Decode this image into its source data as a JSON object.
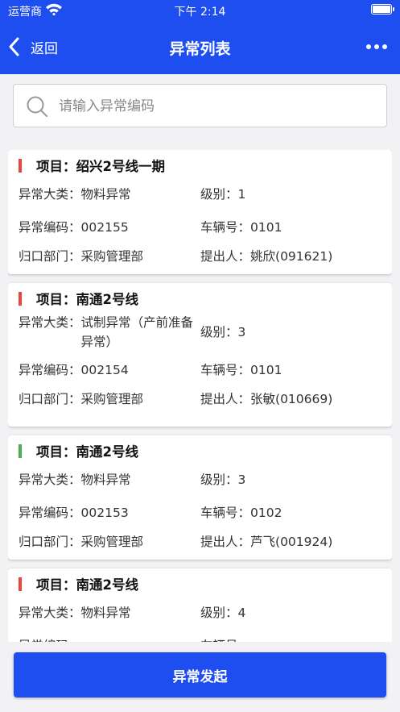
{
  "status_bar": {
    "carrier": "运营商",
    "time": "下午 2:14"
  },
  "nav": {
    "back_label": "返回",
    "title": "异常列表"
  },
  "search": {
    "placeholder": "请输入异常编码",
    "value": ""
  },
  "labels": {
    "category": "异常大类：",
    "level": "级别：",
    "code": "异常编码：",
    "vehicle": "车辆号：",
    "dept": "归口部门：",
    "submitter": "提出人："
  },
  "colors": {
    "primary": "#1f4ef0",
    "flag_red": "#e8453c",
    "flag_green": "#4caf50"
  },
  "items": [
    {
      "project": "项目：绍兴2号线一期",
      "flag_color": "#e8453c",
      "category": "物料异常",
      "level": "1",
      "code": "002155",
      "vehicle": "0101",
      "dept": "采购管理部",
      "submitter": "姚欣(091621)"
    },
    {
      "project": "项目：南通2号线",
      "flag_color": "#e8453c",
      "category": "试制异常（产前准备异常）",
      "level": "3",
      "code": "002154",
      "vehicle": "0101",
      "dept": "采购管理部",
      "submitter": "张敏(010669)"
    },
    {
      "project": "项目：南通2号线",
      "flag_color": "#4caf50",
      "category": "物料异常",
      "level": "3",
      "code": "002153",
      "vehicle": "0102",
      "dept": "采购管理部",
      "submitter": "芦飞(001924)"
    },
    {
      "project": "项目：南通2号线",
      "flag_color": "#e8453c",
      "category": "物料异常",
      "level": "4",
      "code": "",
      "vehicle": "",
      "dept": "",
      "submitter": ""
    }
  ],
  "bottom_button": "异常发起"
}
